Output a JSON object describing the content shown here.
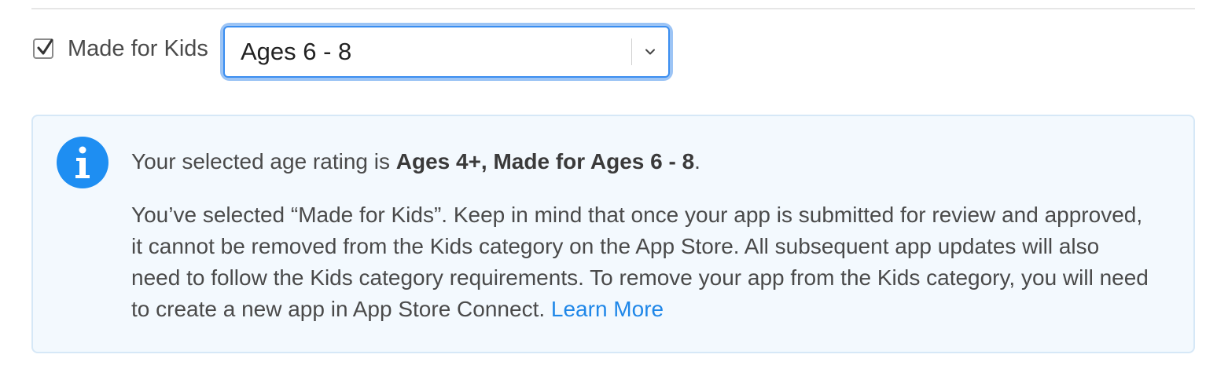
{
  "made_for_kids": {
    "checked": true,
    "label": "Made for Kids"
  },
  "age_select": {
    "value": "Ages 6 - 8"
  },
  "info": {
    "icon": "info-icon",
    "accent_color": "#1e8ef2",
    "rating_prefix": "Your selected age rating is ",
    "rating_value": "Ages 4+, Made for Ages 6 - 8",
    "rating_suffix": ".",
    "notice": "You’ve selected “Made for Kids”. Keep in mind that once your app is submitted for review and approved, it cannot be removed from the Kids category on the App Store. All subsequent app updates will also need to follow the Kids category requirements. To remove your app from the Kids category, you will need to create a new app in App Store Connect. ",
    "learn_more": "Learn More",
    "link_color": "#1f87e8"
  }
}
